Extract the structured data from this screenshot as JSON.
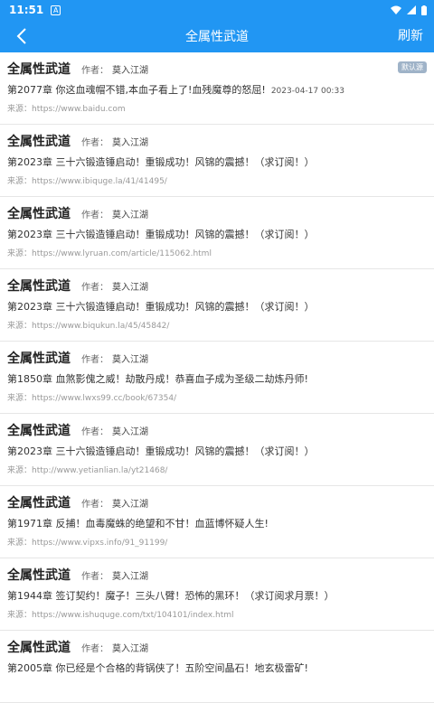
{
  "status": {
    "time": "11:51",
    "notif_glyph": "A"
  },
  "appbar": {
    "title": "全属性武道",
    "refresh_label": "刷新"
  },
  "list": {
    "author_label": "作者：",
    "source_label": "来源：",
    "items": [
      {
        "book_name": "全属性武道",
        "author": "莫入江湖",
        "chapter": "第2077章 你这血魂帽不错,本血子看上了!血残魔尊的怒屈!",
        "date": "2023-04-17 00:33",
        "source": "https://www.baidu.com",
        "badge": "默认源"
      },
      {
        "book_name": "全属性武道",
        "author": "莫入江湖",
        "chapter": "第2023章 三十六锻造锤启动！重锻成功！风锦的震撼！（求订阅！）",
        "date": "",
        "source": "https://www.ibiquge.la/41/41495/",
        "badge": ""
      },
      {
        "book_name": "全属性武道",
        "author": "莫入江湖",
        "chapter": "第2023章 三十六锻造锤启动！重锻成功！风锦的震撼！（求订阅！）",
        "date": "",
        "source": "https://www.lyruan.com/article/115062.html",
        "badge": ""
      },
      {
        "book_name": "全属性武道",
        "author": "莫入江湖",
        "chapter": "第2023章 三十六锻造锤启动！重锻成功！风锦的震撼！（求订阅！）",
        "date": "",
        "source": "https://www.biqukun.la/45/45842/",
        "badge": ""
      },
      {
        "book_name": "全属性武道",
        "author": "莫入江湖",
        "chapter": "第1850章 血煞影傀之威！劫散丹成！恭喜血子成为圣级二劫炼丹师!",
        "date": "",
        "source": "https://www.lwxs99.cc/book/67354/",
        "badge": ""
      },
      {
        "book_name": "全属性武道",
        "author": "莫入江湖",
        "chapter": "第2023章 三十六锻造锤启动！重锻成功！风锦的震撼！（求订阅！）",
        "date": "",
        "source": "http://www.yetianlian.la/yt21468/",
        "badge": ""
      },
      {
        "book_name": "全属性武道",
        "author": "莫入江湖",
        "chapter": "第1971章 反捕！血毒魔蛛的绝望和不甘！血蓝博怀疑人生!",
        "date": "",
        "source": "https://www.vipxs.info/91_91199/",
        "badge": ""
      },
      {
        "book_name": "全属性武道",
        "author": "莫入江湖",
        "chapter": "第1944章 签订契约！魔子！三头八臂！恐怖的黑环！（求订阅求月票！）",
        "date": "",
        "source": "https://www.ishuquge.com/txt/104101/index.html",
        "badge": ""
      },
      {
        "book_name": "全属性武道",
        "author": "莫入江湖",
        "chapter": "第2005章 你已经是个合格的背锅侠了！五阶空间晶石！地玄极雷矿!",
        "date": "",
        "source": "",
        "badge": ""
      }
    ]
  }
}
